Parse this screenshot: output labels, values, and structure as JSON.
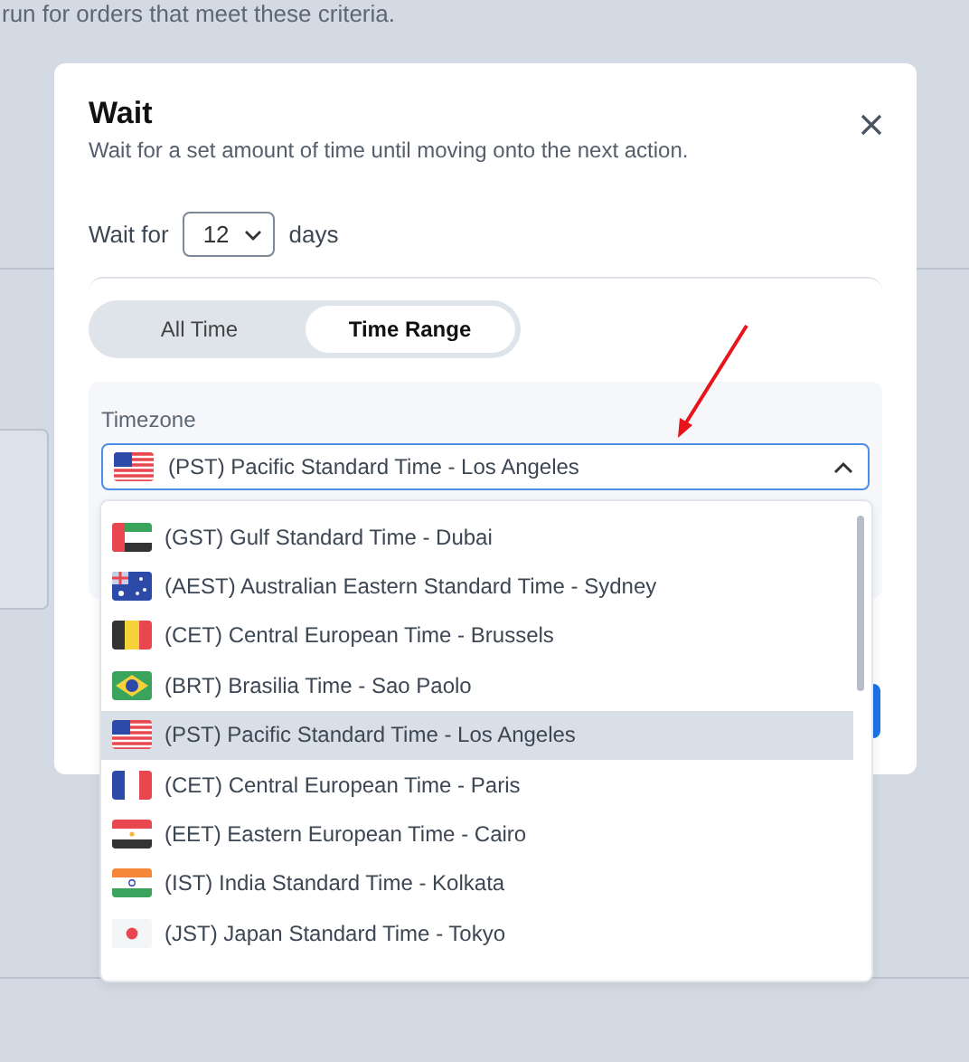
{
  "background": {
    "text": "run for orders that meet these criteria."
  },
  "dialog": {
    "title": "Wait",
    "subtitle": "Wait for a set amount of time until moving onto the next action.",
    "wait_label": "Wait for",
    "wait_value": "12",
    "wait_unit": "days",
    "tabs": [
      {
        "label": "All Time",
        "selected": false
      },
      {
        "label": "Time Range",
        "selected": true
      }
    ],
    "timezone": {
      "label": "Timezone",
      "value": {
        "label": "(PST) Pacific Standard Time - Los Angeles",
        "kind": "us"
      },
      "expanded": true,
      "options": [
        {
          "label": "(GST) Gulf Standard Time - Dubai",
          "kind": "ae",
          "selected": false
        },
        {
          "label": "(AEST) Australian Eastern Standard Time - Sydney",
          "kind": "au",
          "selected": false
        },
        {
          "label": "(CET) Central European Time - Brussels",
          "kind": "be",
          "selected": false
        },
        {
          "label": "(BRT) Brasilia Time - Sao Paolo",
          "kind": "br",
          "selected": false
        },
        {
          "label": "(PST) Pacific Standard Time - Los Angeles",
          "kind": "us",
          "selected": true
        },
        {
          "label": "(CET) Central European Time - Paris",
          "kind": "fr",
          "selected": false
        },
        {
          "label": "(EET) Eastern European Time - Cairo",
          "kind": "eg",
          "selected": false
        },
        {
          "label": "(IST) India Standard Time - Kolkata",
          "kind": "in",
          "selected": false
        },
        {
          "label": "(JST) Japan Standard Time - Tokyo",
          "kind": "jp",
          "selected": false
        }
      ]
    }
  }
}
